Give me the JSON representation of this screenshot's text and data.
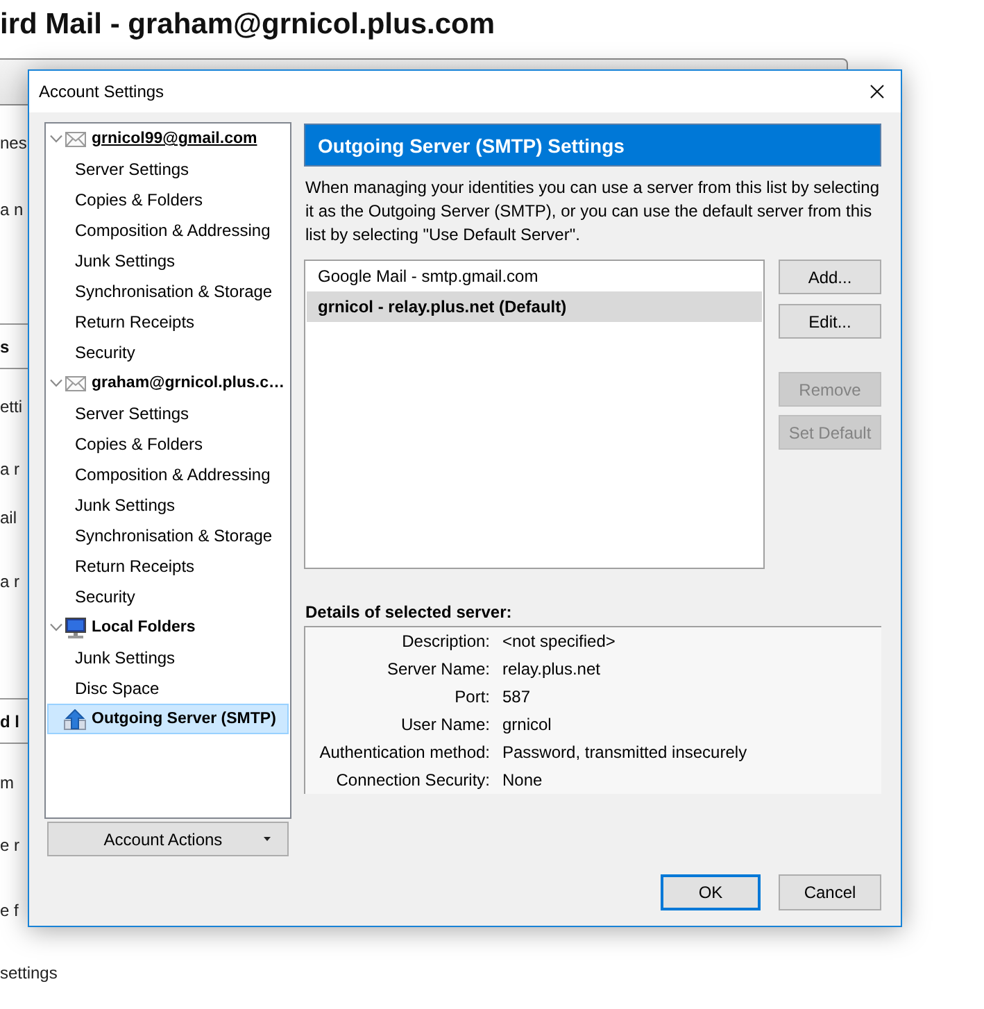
{
  "background": {
    "title": "ird Mail - graham@grnicol.plus.com",
    "fragments": [
      {
        "kind": "text",
        "text": "nes"
      },
      {
        "kind": "text",
        "text": "a n"
      },
      {
        "kind": "heading",
        "text": "s"
      },
      {
        "kind": "text",
        "text": "etti"
      },
      {
        "kind": "text",
        "text": "a r"
      },
      {
        "kind": "text",
        "text": "ail"
      },
      {
        "kind": "text",
        "text": "a r"
      },
      {
        "kind": "heading",
        "text": "d l"
      },
      {
        "kind": "text",
        "text": "m"
      },
      {
        "kind": "text",
        "text": "e r"
      },
      {
        "kind": "text",
        "text": "e f"
      },
      {
        "kind": "text",
        "text": "settings"
      }
    ]
  },
  "dialog": {
    "title": "Account Settings",
    "tree": [
      {
        "kind": "mail",
        "label": "grnicol99@gmail.com",
        "expanded": true,
        "hovered": true,
        "selected": false,
        "children": [
          {
            "label": "Server Settings",
            "selected": false
          },
          {
            "label": "Copies & Folders",
            "selected": false
          },
          {
            "label": "Composition & Addressing",
            "selected": false
          },
          {
            "label": "Junk Settings",
            "selected": false
          },
          {
            "label": "Synchronisation & Storage",
            "selected": false
          },
          {
            "label": "Return Receipts",
            "selected": false
          },
          {
            "label": "Security",
            "selected": false
          }
        ]
      },
      {
        "kind": "mail",
        "label": "graham@grnicol.plus.c…",
        "expanded": true,
        "hovered": false,
        "selected": false,
        "children": [
          {
            "label": "Server Settings",
            "selected": false
          },
          {
            "label": "Copies & Folders",
            "selected": false
          },
          {
            "label": "Composition & Addressing",
            "selected": false
          },
          {
            "label": "Junk Settings",
            "selected": false
          },
          {
            "label": "Synchronisation & Storage",
            "selected": false
          },
          {
            "label": "Return Receipts",
            "selected": false
          },
          {
            "label": "Security",
            "selected": false
          }
        ]
      },
      {
        "kind": "local",
        "label": "Local Folders",
        "expanded": true,
        "hovered": false,
        "selected": false,
        "children": [
          {
            "label": "Junk Settings",
            "selected": false
          },
          {
            "label": "Disc Space",
            "selected": false
          }
        ]
      },
      {
        "kind": "smtp",
        "label": "Outgoing Server (SMTP)",
        "hovered": false,
        "selected": true
      }
    ],
    "account_actions": {
      "label": "Account Actions"
    },
    "panel": {
      "title": "Outgoing Server (SMTP) Settings",
      "description": "When managing your identities you can use a server from this list by selecting it as the Outgoing Server (SMTP), or you can use the default server from this list by selecting \"Use Default Server\".",
      "servers": [
        {
          "label": "Google Mail - smtp.gmail.com",
          "selected": false,
          "default": false
        },
        {
          "label": "grnicol - relay.plus.net (Default)",
          "selected": true,
          "default": true
        }
      ],
      "buttons": [
        {
          "label": "Add...",
          "disabled": false
        },
        {
          "label": "Edit...",
          "disabled": false
        },
        {
          "label": "Remove",
          "disabled": true
        },
        {
          "label": "Set Default",
          "disabled": true
        }
      ],
      "details_title": "Details of selected server:",
      "details": [
        {
          "label": "Description:",
          "value": "<not specified>"
        },
        {
          "label": "Server Name:",
          "value": "relay.plus.net"
        },
        {
          "label": "Port:",
          "value": "587"
        },
        {
          "label": "User Name:",
          "value": "grnicol"
        },
        {
          "label": "Authentication method:",
          "value": "Password, transmitted insecurely"
        },
        {
          "label": "Connection Security:",
          "value": "None"
        }
      ]
    },
    "footer_buttons": [
      {
        "label": "OK",
        "focused": true
      },
      {
        "label": "Cancel",
        "focused": false
      }
    ]
  }
}
